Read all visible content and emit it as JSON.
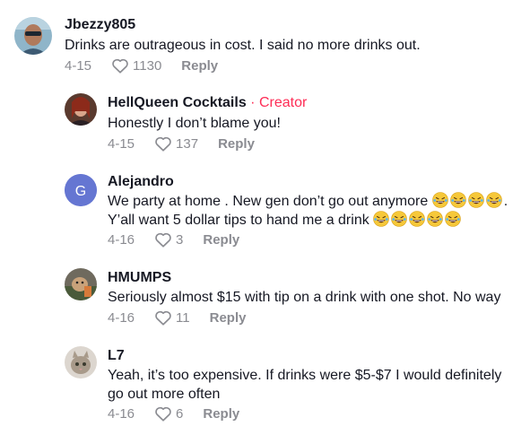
{
  "comments": [
    {
      "username": "Jbezzy805",
      "text": "Drinks are outrageous in cost. I said no more drinks out.",
      "date": "4-15",
      "likes": "1130",
      "reply_label": "Reply"
    },
    {
      "username": "HellQueen Cocktails",
      "creator_tag": " · Creator",
      "text": "Honestly I don’t blame you!",
      "date": "4-15",
      "likes": "137",
      "reply_label": "Reply"
    },
    {
      "username": "Alejandro",
      "avatar_letter": "G",
      "text_line1": "We party at home . New gen don’t go out anymore",
      "text_line1_end": ".",
      "text_line2": "Y’all want 5 dollar tips to hand me a drink",
      "date": "4-16",
      "likes": "3",
      "reply_label": "Reply"
    },
    {
      "username": "HMUMPS",
      "text": "Seriously almost $15 with tip on a drink with one shot. No way",
      "date": "4-16",
      "likes": "11",
      "reply_label": "Reply"
    },
    {
      "username": "L7",
      "text_line1": "Yeah, it’s too expensive. If drinks were $5-$7 I would definitely",
      "text_line2": "go out more often",
      "date": "4-16",
      "likes": "6",
      "reply_label": "Reply"
    }
  ],
  "colors": {
    "creator": "#fe2c55",
    "meta": "#8a8b91",
    "avatar_letter_bg": "#6576d2"
  },
  "icons": {
    "like": "heart-outline-icon",
    "emoji": "laughing-tears-emoji"
  }
}
